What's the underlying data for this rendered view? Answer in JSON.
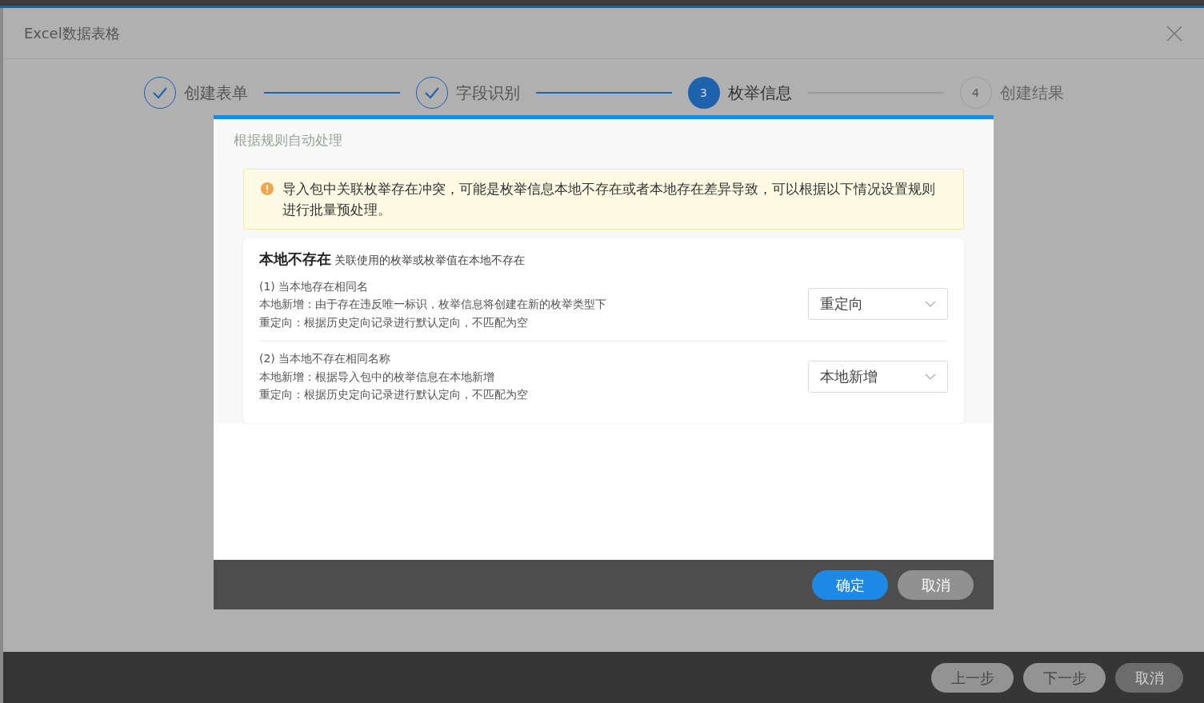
{
  "window": {
    "title": "Excel数据表格"
  },
  "steps": [
    {
      "label": "创建表单",
      "kind": "done"
    },
    {
      "label": "字段识别",
      "kind": "done"
    },
    {
      "label": "枚举信息",
      "kind": "active",
      "number": "3"
    },
    {
      "label": "创建结果",
      "kind": "pending",
      "number": "4"
    }
  ],
  "dialog": {
    "title": "根据规则自动处理",
    "alert": "导入包中关联枚举存在冲突，可能是枚举信息本地不存在或者本地存在差异导致，可以根据以下情况设置规则进行批量预处理。",
    "section": {
      "title": "本地不存在",
      "subtitle": "关联使用的枚举或枚举值在本地不存在",
      "rules": [
        {
          "heading": "(1) 当本地存在相同名",
          "lines": [
            "本地新增：由于存在违反唯一标识，枚举信息将创建在新的枚举类型下",
            "重定向：根据历史定向记录进行默认定向，不匹配为空"
          ],
          "select": "重定向"
        },
        {
          "heading": "(2) 当本地不存在相同名称",
          "lines": [
            "本地新增：根据导入包中的枚举信息在本地新增",
            "重定向：根据历史定向记录进行默认定向，不匹配为空"
          ],
          "select": "本地新增"
        }
      ]
    },
    "buttons": [
      {
        "label": "确定",
        "kind": "primary"
      },
      {
        "label": "取消",
        "kind": "secondary"
      }
    ]
  },
  "footer_buttons": [
    {
      "label": "上一步",
      "kind": "disabled"
    },
    {
      "label": "下一步",
      "kind": "disabled"
    },
    {
      "label": "取消",
      "kind": "normal"
    }
  ]
}
